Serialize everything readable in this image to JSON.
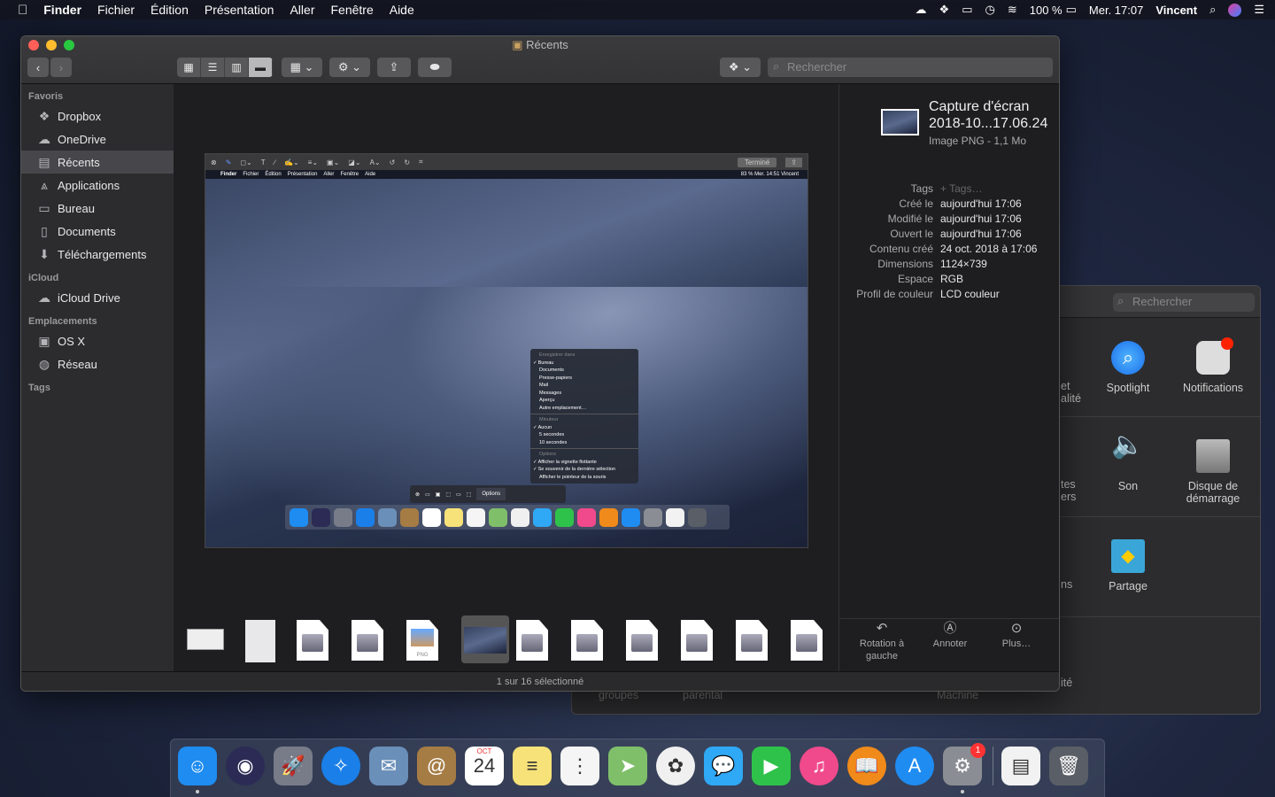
{
  "menubar": {
    "apple": "",
    "app": "Finder",
    "items": [
      "Fichier",
      "Édition",
      "Présentation",
      "Aller",
      "Fenêtre",
      "Aide"
    ],
    "battery": "100 %",
    "clock": "Mer. 17:07",
    "user": "Vincent"
  },
  "prefs": {
    "search_placeholder": "Rechercher",
    "items": [
      {
        "label": "Spotlight",
        "icon": "spotlight-icon"
      },
      {
        "label": "Notifications",
        "icon": "notifications-icon"
      },
      {
        "label": "Son",
        "icon": "sound-icon"
      },
      {
        "label": "Disque de démarrage",
        "icon": "startup-disk-icon"
      },
      {
        "label": "Partage",
        "icon": "sharing-icon"
      }
    ],
    "cut_labels": [
      "et",
      "alité",
      "tes",
      "ers",
      "ns",
      "ité",
      "groupes",
      "parental",
      "Machine"
    ]
  },
  "finder": {
    "title": "Récents",
    "search_placeholder": "Rechercher",
    "sidebar": {
      "sections": [
        {
          "header": "Favoris",
          "items": [
            {
              "label": "Dropbox",
              "icon": "dropbox-icon"
            },
            {
              "label": "OneDrive",
              "icon": "cloud-icon"
            },
            {
              "label": "Récents",
              "icon": "recents-icon",
              "selected": true
            },
            {
              "label": "Applications",
              "icon": "applications-icon"
            },
            {
              "label": "Bureau",
              "icon": "desktop-icon"
            },
            {
              "label": "Documents",
              "icon": "documents-icon"
            },
            {
              "label": "Téléchargements",
              "icon": "downloads-icon"
            }
          ]
        },
        {
          "header": "iCloud",
          "items": [
            {
              "label": "iCloud Drive",
              "icon": "icloud-icon"
            }
          ]
        },
        {
          "header": "Emplacements",
          "items": [
            {
              "label": "OS X",
              "icon": "disk-icon"
            },
            {
              "label": "Réseau",
              "icon": "network-icon"
            }
          ]
        },
        {
          "header": "Tags",
          "items": []
        }
      ]
    },
    "preview": {
      "toolbar_done": "Terminé",
      "inner_menubar": [
        "Finder",
        "Fichier",
        "Édition",
        "Présentation",
        "Aller",
        "Fenêtre",
        "Aide"
      ],
      "inner_status": "83 %  Mer. 14:51  Vincent",
      "popup": {
        "save_header": "Enregistrer dans",
        "save": [
          "Bureau",
          "Documents",
          "Presse-papiers",
          "Mail",
          "Messages",
          "Aperçu",
          "Autre emplacement…"
        ],
        "timer_header": "Minuteur",
        "timer": [
          "Aucun",
          "5 secondes",
          "10 secondes"
        ],
        "options_header": "Options",
        "options": [
          "Afficher la vignette flottante",
          "Se souvenir de la dernière sélection",
          "Afficher le pointeur de la souris"
        ],
        "checked": [
          "Bureau",
          "Aucun",
          "Afficher la vignette flottante",
          "Se souvenir de la dernière sélection"
        ]
      },
      "options_button": "Options",
      "png_label": "PNG",
      "thumbnails": [
        "screenshot",
        "document-scan",
        "disk-doc",
        "disk-doc",
        "png",
        "screenshot-selected",
        "disk-doc",
        "disk-doc",
        "disk-doc",
        "disk-doc",
        "disk-doc",
        "disk-doc"
      ]
    },
    "inspector": {
      "name_line1": "Capture d'écran",
      "name_line2": "2018-10...17.06.24",
      "type": "Image PNG - 1,1 Mo",
      "meta": [
        {
          "k": "Tags",
          "v": "+ Tags…"
        },
        {
          "k": "Créé le",
          "v": "aujourd'hui 17:06"
        },
        {
          "k": "Modifié le",
          "v": "aujourd'hui 17:06"
        },
        {
          "k": "Ouvert le",
          "v": "aujourd'hui 17:06"
        },
        {
          "k": "Contenu créé",
          "v": "24 oct. 2018 à 17:06"
        },
        {
          "k": "Dimensions",
          "v": "1124×739"
        },
        {
          "k": "Espace",
          "v": "RGB"
        },
        {
          "k": "Profil de couleur",
          "v": "LCD couleur"
        }
      ],
      "actions": [
        {
          "label": "Rotation à gauche",
          "icon": "rotate-left-icon"
        },
        {
          "label": "Annoter",
          "icon": "markup-icon"
        },
        {
          "label": "Plus…",
          "icon": "more-icon"
        }
      ]
    },
    "status": "1 sur 16 sélectionné"
  },
  "dock": {
    "items": [
      {
        "name": "finder",
        "color": "#1e8cf0",
        "glyph": "☺",
        "running": true
      },
      {
        "name": "siri",
        "color": "#2b2b55",
        "glyph": "◉"
      },
      {
        "name": "launchpad",
        "color": "#777c88",
        "glyph": "🚀"
      },
      {
        "name": "safari",
        "color": "#1a7fe8",
        "glyph": "✧"
      },
      {
        "name": "mail",
        "color": "#6a8fb8",
        "glyph": "✉"
      },
      {
        "name": "contacts",
        "color": "#a67c45",
        "glyph": "@"
      },
      {
        "name": "calendar",
        "color": "#ffffff",
        "glyph": "24",
        "month": "OCT"
      },
      {
        "name": "notes",
        "color": "#f7e27a",
        "glyph": "≡"
      },
      {
        "name": "reminders",
        "color": "#f5f5f5",
        "glyph": "⋮"
      },
      {
        "name": "maps",
        "color": "#7fbf6a",
        "glyph": "➤"
      },
      {
        "name": "photos",
        "color": "#f0f0f0",
        "glyph": "✿"
      },
      {
        "name": "messages",
        "color": "#2fa8f5",
        "glyph": "💬"
      },
      {
        "name": "facetime",
        "color": "#2fc24a",
        "glyph": "▶"
      },
      {
        "name": "itunes",
        "color": "#f04a8c",
        "glyph": "♫"
      },
      {
        "name": "books",
        "color": "#f08a1a",
        "glyph": "📖"
      },
      {
        "name": "app-store",
        "color": "#1f8cf2",
        "glyph": "A"
      },
      {
        "name": "system-preferences",
        "color": "#8a8d93",
        "glyph": "⚙",
        "badge": "1",
        "running": true
      },
      {
        "name": "document",
        "color": "#f2f2f2",
        "glyph": "▤"
      },
      {
        "name": "trash",
        "color": "#5a5e66",
        "glyph": "🗑"
      }
    ]
  },
  "colors": {
    "close": "#ff5f57",
    "minimize": "#febc2e",
    "zoom": "#28c840",
    "selection": "#47474b"
  }
}
